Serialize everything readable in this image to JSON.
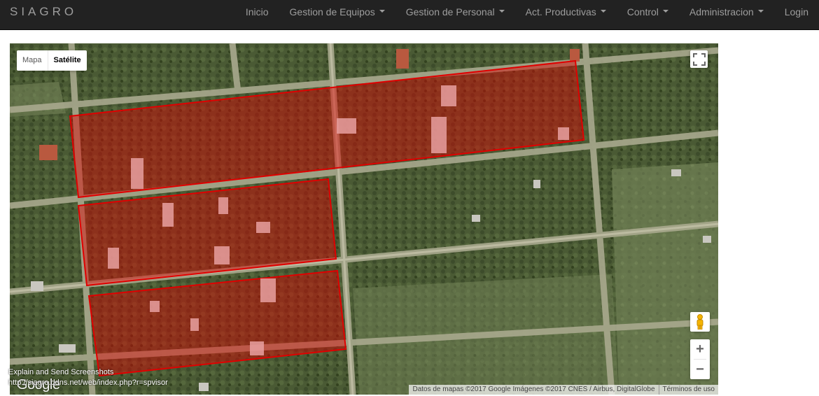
{
  "navbar": {
    "brand": "SIAGRO",
    "items": [
      {
        "label": "Inicio",
        "dropdown": false
      },
      {
        "label": "Gestion de Equipos",
        "dropdown": true
      },
      {
        "label": "Gestion de Personal",
        "dropdown": true
      },
      {
        "label": "Act. Productivas",
        "dropdown": true
      },
      {
        "label": "Control",
        "dropdown": true
      },
      {
        "label": "Administracion",
        "dropdown": true
      },
      {
        "label": "Login",
        "dropdown": false
      }
    ]
  },
  "map": {
    "map_type": {
      "map_label": "Mapa",
      "satellite_label": "Satélite",
      "selected": "Satélite"
    },
    "zoom": {
      "in_label": "+",
      "out_label": "−"
    },
    "attribution": "Datos de mapas ©2017 Google Imágenes ©2017 CNES / Airbus, DigitalGlobe",
    "terms": "Términos de uso",
    "logo": "Google",
    "polygon_color": "#e00000",
    "icons": [
      "fullscreen-icon",
      "pegman-icon"
    ]
  },
  "overlay": {
    "line1": "Explain and Send Screenshots",
    "line2": "http://siagro.ddns.net/web/index.php?r=spvisor"
  }
}
